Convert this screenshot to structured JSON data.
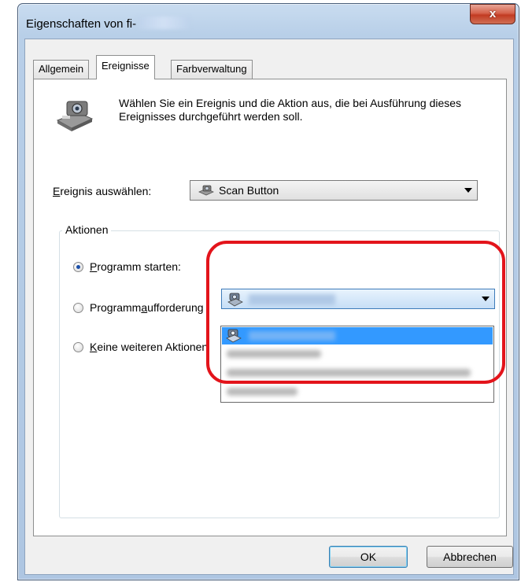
{
  "window": {
    "title": "Eigenschaften von fi-",
    "close_label": "x"
  },
  "tabs": [
    {
      "label": "Allgemein",
      "active": false
    },
    {
      "label": "Ereignisse",
      "active": true
    },
    {
      "label": "Farbverwaltung",
      "active": false
    }
  ],
  "description": "Wählen Sie ein Ereignis und die Aktion aus, die bei Ausführung dieses Ereignisses durchgeführt werden soll.",
  "event_select": {
    "label_prefix": "E",
    "label_rest": "reignis auswählen:",
    "value": "Scan Button",
    "icon": "scanner-icon"
  },
  "actions": {
    "group_title": "Aktionen",
    "start_program": {
      "prefix": "",
      "accel": "P",
      "rest": "rogramm starten:",
      "checked": true
    },
    "prompt_program": {
      "prefix": "Programm",
      "accel": "a",
      "rest": "ufforderung",
      "checked": false
    },
    "no_action": {
      "prefix": "",
      "accel": "K",
      "rest": "eine weiteren Aktionen",
      "checked": false
    }
  },
  "buttons": {
    "ok": "OK",
    "cancel": "Abbrechen"
  },
  "colors": {
    "highlight_ring": "#e3141b",
    "selection": "#3399ff"
  }
}
